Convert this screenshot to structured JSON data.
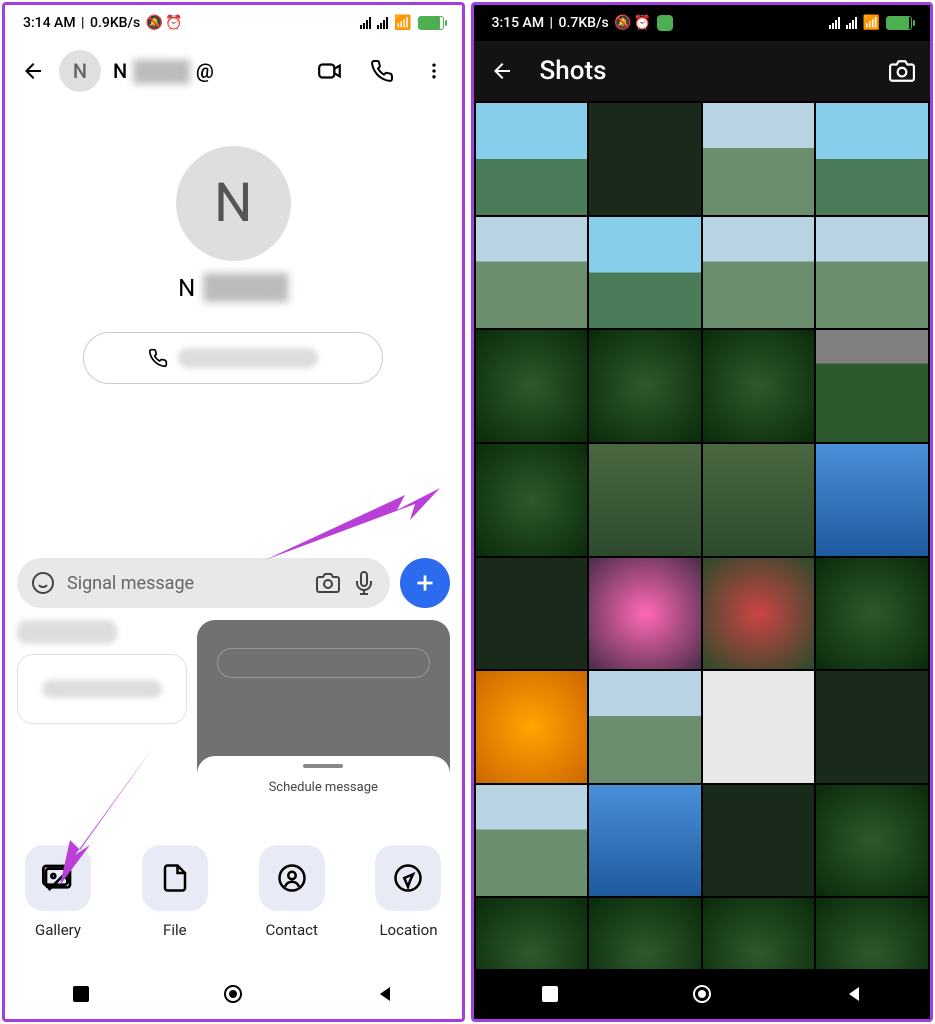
{
  "left": {
    "status": {
      "time": "3:14 AM",
      "speed": "0.9KB/s"
    },
    "contact": {
      "initial": "N",
      "name": "N",
      "at": "@"
    },
    "composer": {
      "placeholder": "Signal message"
    },
    "schedule": "Schedule message",
    "attachments": [
      {
        "label": "Gallery",
        "icon": "image"
      },
      {
        "label": "File",
        "icon": "file"
      },
      {
        "label": "Contact",
        "icon": "person"
      },
      {
        "label": "Location",
        "icon": "location"
      }
    ]
  },
  "right": {
    "status": {
      "time": "3:15 AM",
      "speed": "0.7KB/s"
    },
    "title": "Shots"
  }
}
